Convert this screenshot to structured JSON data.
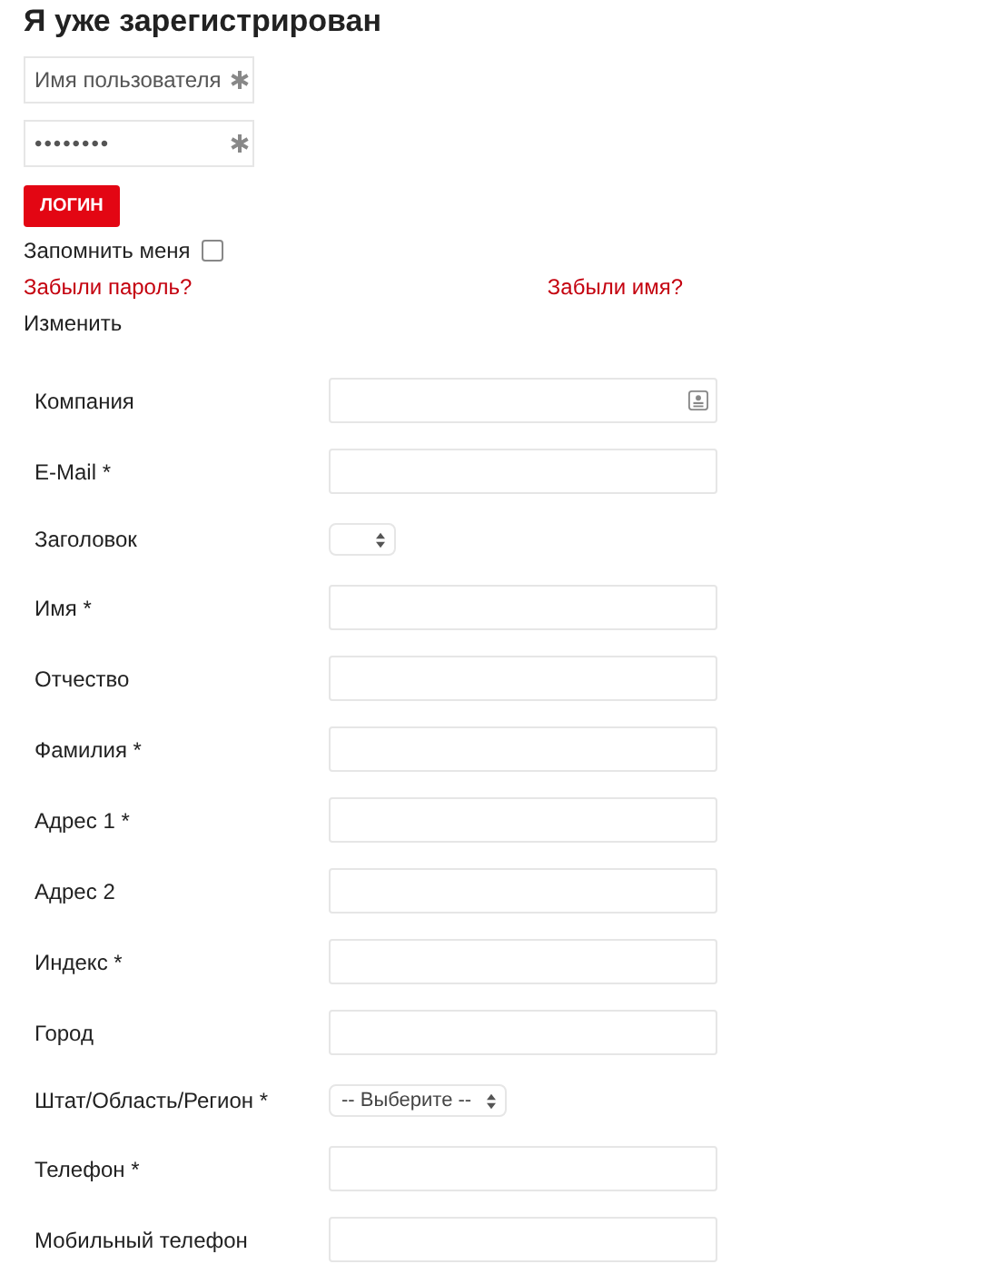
{
  "login": {
    "title": "Я уже зарегистрирован",
    "username": {
      "placeholder": "Имя пользователя",
      "required": true
    },
    "password": {
      "value": "••••••••",
      "required": true
    },
    "button": "ЛОГИН",
    "remember": {
      "label": "Запомнить меня",
      "checked": false
    },
    "links": [
      "Забыли пароль?",
      "Забыли имя?"
    ],
    "change": "Изменить"
  },
  "fields": [
    {
      "label": "Компания",
      "kind": "text",
      "contact_icon": true
    },
    {
      "label": "E-Mail *",
      "kind": "text"
    },
    {
      "label": "Заголовок",
      "kind": "select"
    },
    {
      "label": "Имя *",
      "kind": "text"
    },
    {
      "label": "Отчество",
      "kind": "text"
    },
    {
      "label": "Фамилия *",
      "kind": "text"
    },
    {
      "label": "Адрес 1 *",
      "kind": "text"
    },
    {
      "label": "Адрес 2",
      "kind": "text"
    },
    {
      "label": "Индекс *",
      "kind": "text"
    },
    {
      "label": "Город",
      "kind": "text"
    },
    {
      "label": "Штат/Область/Регион *",
      "kind": "select",
      "value": "-- Выберите --"
    },
    {
      "label": "Телефон *",
      "kind": "text"
    },
    {
      "label": "Мобильный телефон",
      "kind": "text"
    }
  ]
}
